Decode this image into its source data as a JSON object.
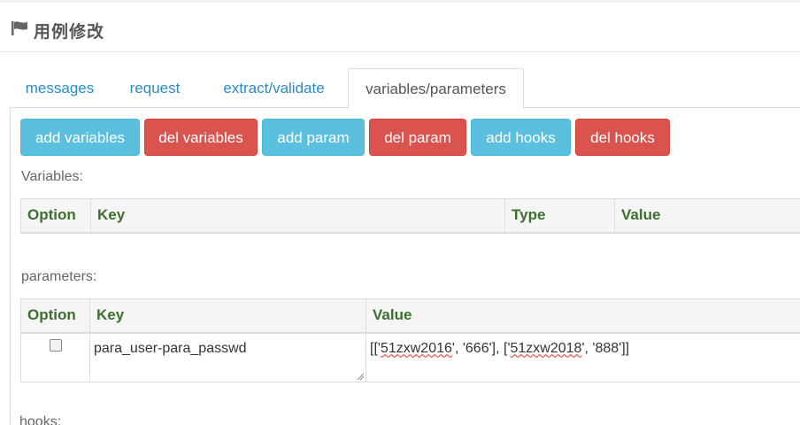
{
  "header": {
    "title": "用例修改",
    "icon": "flag-icon"
  },
  "tabs": [
    {
      "label": "messages",
      "active": false
    },
    {
      "label": "request",
      "active": false
    },
    {
      "label": "extract/validate",
      "active": false
    },
    {
      "label": "variables/parameters",
      "active": true
    }
  ],
  "toolbar": {
    "add_variables": "add variables",
    "del_variables": "del variables",
    "add_param": "add param",
    "del_param": "del param",
    "add_hooks": "add hooks",
    "del_hooks": "del hooks"
  },
  "colors": {
    "info": "#5bc0de",
    "danger": "#d9534f",
    "link": "#2a8bc4",
    "header_text": "#3c6e2e"
  },
  "variables": {
    "label": "Variables:",
    "columns": [
      "Option",
      "Key",
      "Type",
      "Value"
    ],
    "rows": []
  },
  "parameters": {
    "label": "parameters:",
    "columns": [
      "Option",
      "Key",
      "Value"
    ],
    "rows": [
      {
        "checked": false,
        "key": "para_user-para_passwd",
        "value_parts": [
          "[['",
          "51zxw2016",
          "', '666'], ['",
          "51zxw2018",
          "', '888']]"
        ]
      }
    ]
  },
  "hooks": {
    "label": "hooks:"
  }
}
